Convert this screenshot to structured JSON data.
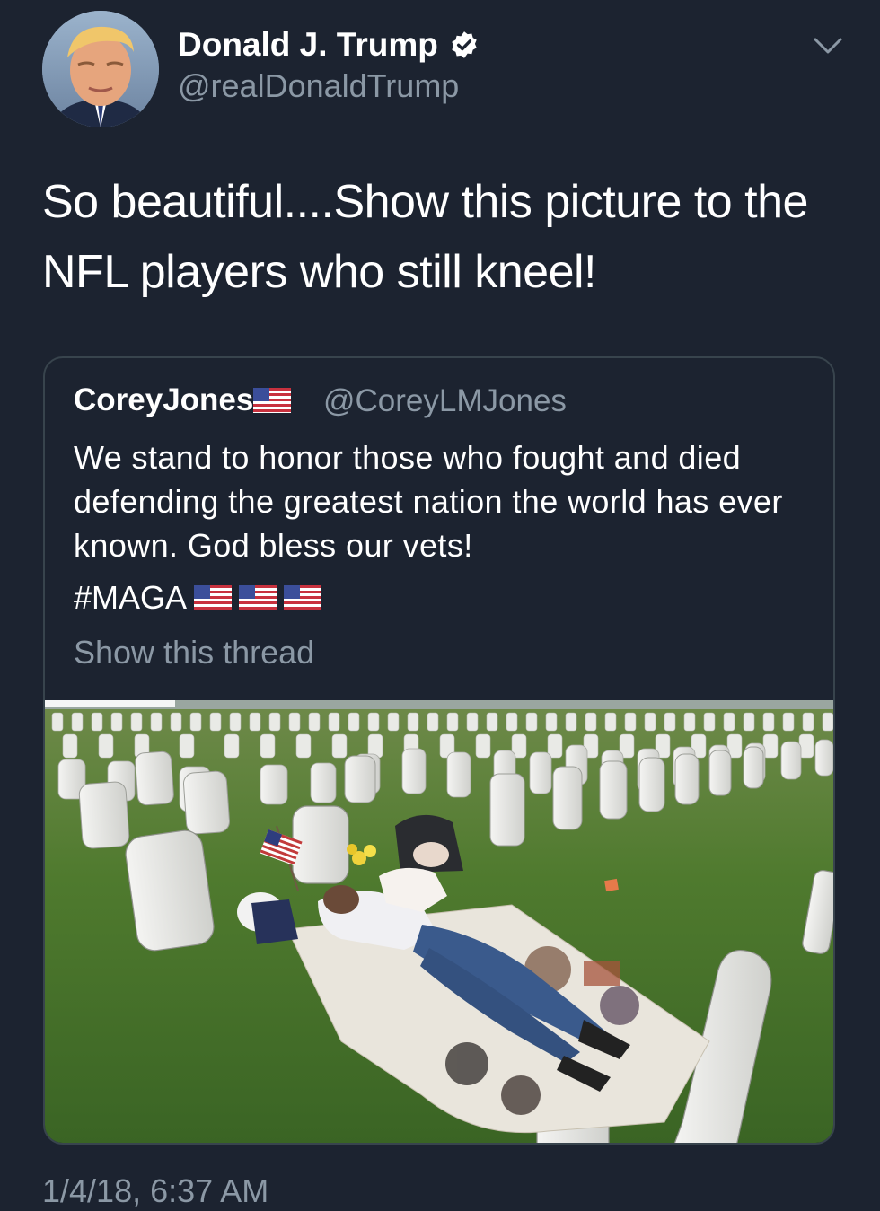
{
  "tweet": {
    "author_name": "Donald J. Trump",
    "author_handle": "@realDonaldTrump",
    "verified": true,
    "text": "So beautiful....Show this picture to the NFL players who still kneel!",
    "timestamp": "1/4/18, 6:37 AM",
    "menu_icon": "chevron-down-icon"
  },
  "quoted": {
    "author_name": "CoreyJones",
    "author_handle": "@CoreyLMJones",
    "text": "We stand to honor those who fought and died defending the greatest nation the world has ever known. God bless our vets!",
    "hashtag": "#MAGA",
    "show_thread": "Show this thread",
    "photo_icon": "cemetery-photo"
  },
  "colors": {
    "background": "#1c2330",
    "text": "#ffffff",
    "secondary_text": "#8b98a5",
    "border": "#38444d"
  }
}
